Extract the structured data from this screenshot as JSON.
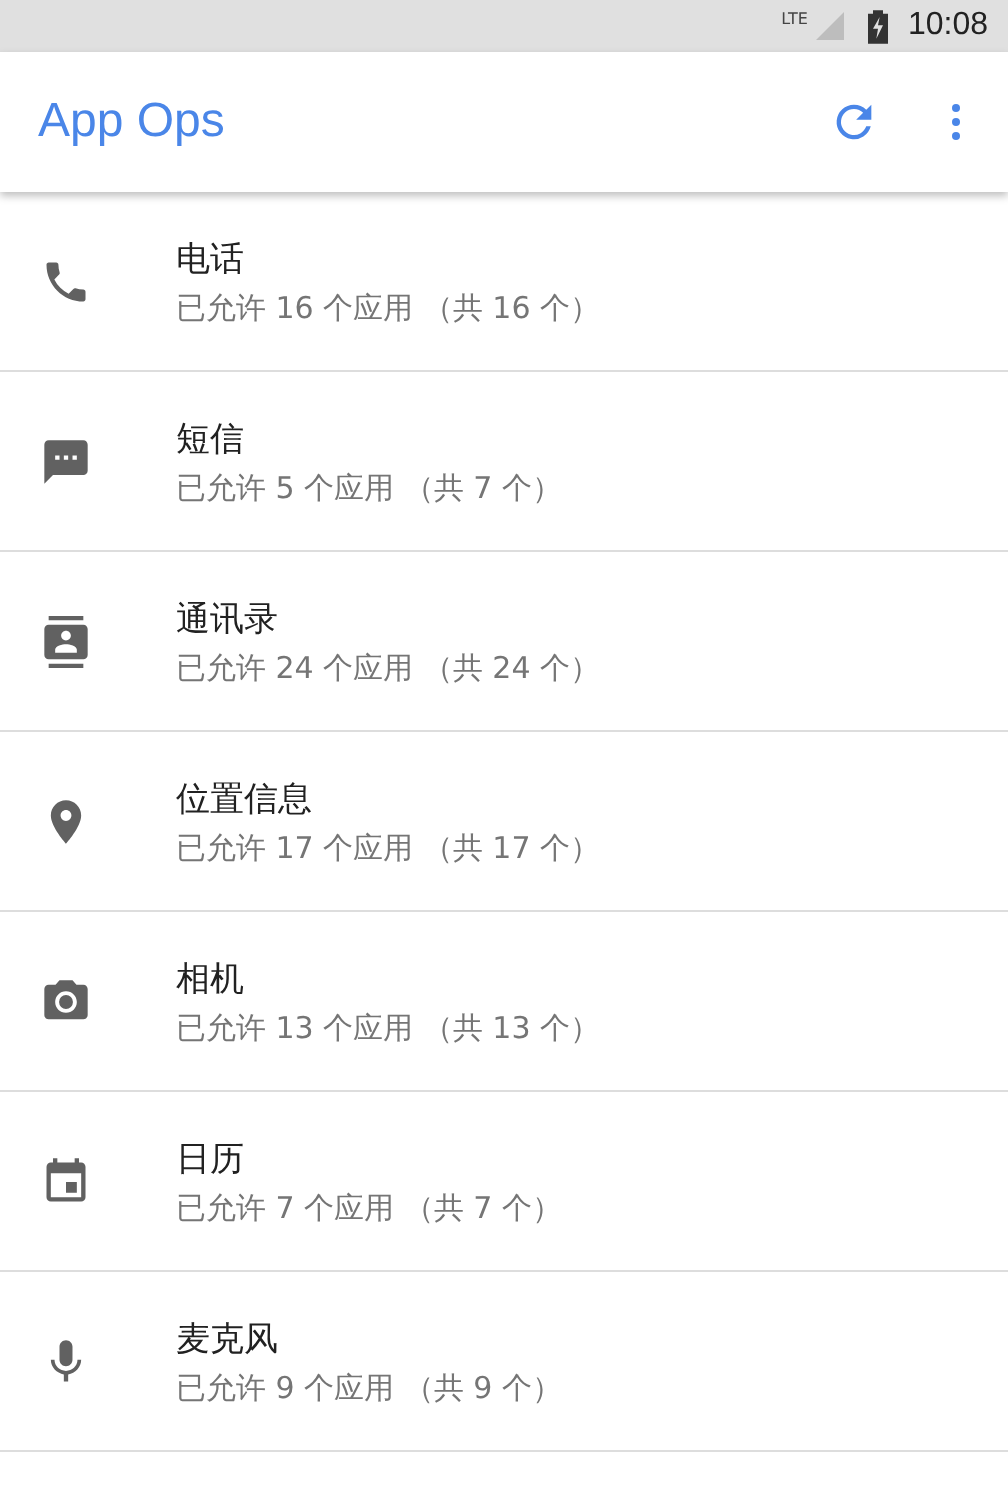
{
  "status_bar": {
    "network": "LTE",
    "time": "10:08"
  },
  "toolbar": {
    "title": "App Ops"
  },
  "items": [
    {
      "kind": "phone",
      "title": "电话",
      "summary": "已允许 16 个应用 （共 16 个）"
    },
    {
      "kind": "message",
      "title": "短信",
      "summary": "已允许 5 个应用 （共 7 个）"
    },
    {
      "kind": "contacts",
      "title": "通讯录",
      "summary": "已允许 24 个应用 （共 24 个）"
    },
    {
      "kind": "location",
      "title": "位置信息",
      "summary": "已允许 17 个应用 （共 17 个）"
    },
    {
      "kind": "camera",
      "title": "相机",
      "summary": "已允许 13 个应用 （共 13 个）"
    },
    {
      "kind": "calendar",
      "title": "日历",
      "summary": "已允许 7 个应用 （共 7 个）"
    },
    {
      "kind": "mic",
      "title": "麦克风",
      "summary": "已允许 9 个应用 （共 9 个）"
    }
  ]
}
